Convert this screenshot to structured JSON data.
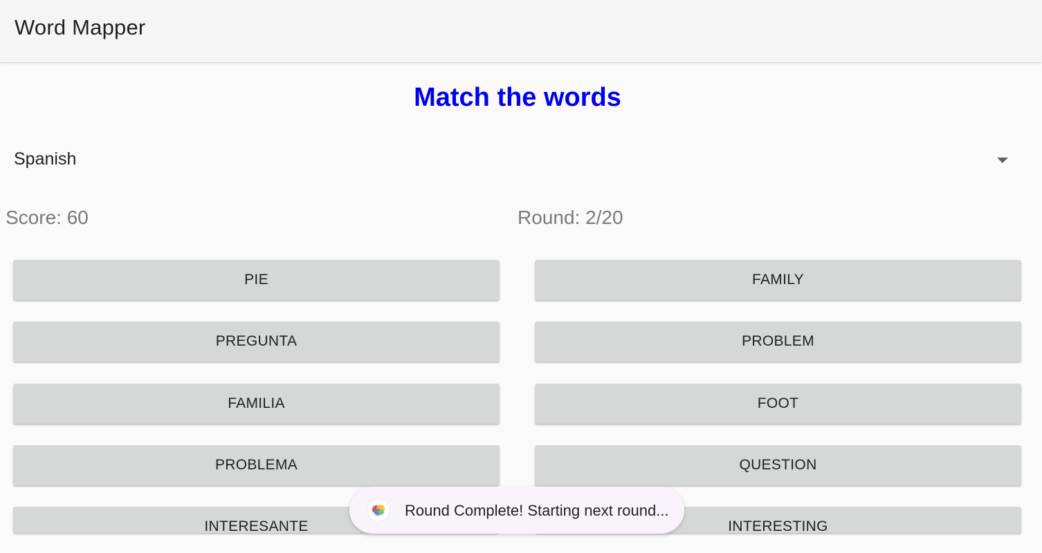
{
  "app": {
    "title": "Word Mapper"
  },
  "main": {
    "heading": "Match the words",
    "heading_color": "#0000ee",
    "language_select": {
      "value": "Spanish",
      "icon": "dropdown-caret-icon"
    },
    "score_text": "Score: 60",
    "round_text": "Round: 2/20"
  },
  "left_words": [
    "PIE",
    "PREGUNTA",
    "FAMILIA",
    "PROBLEMA",
    "INTERESANTE"
  ],
  "right_words": [
    "FAMILY",
    "PROBLEM",
    "FOOT",
    "QUESTION",
    "INTERESTING"
  ],
  "toast": {
    "message": "Round Complete! Starting next round...",
    "icon": "app-logo-icon"
  }
}
